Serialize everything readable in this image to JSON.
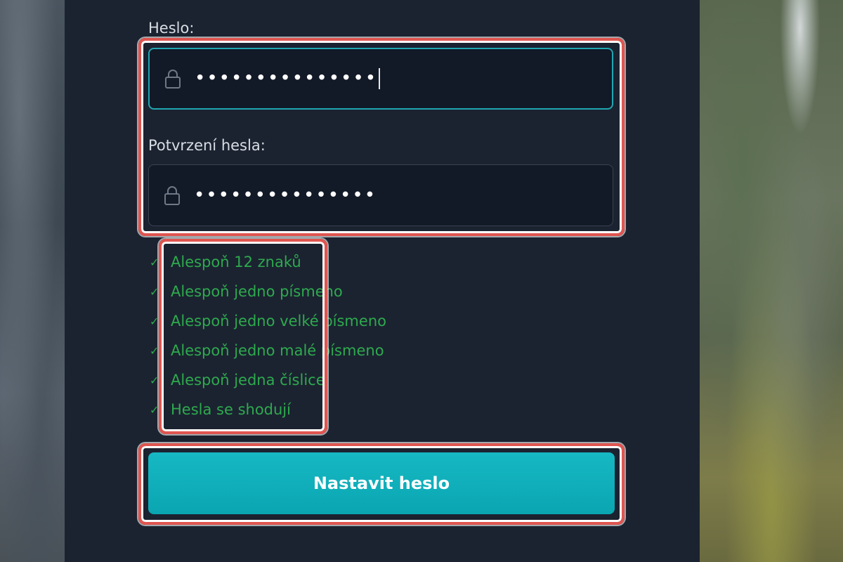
{
  "form": {
    "password_label": "Heslo:",
    "password_value": "•••••••••••••••",
    "confirm_label": "Potvrzení hesla:",
    "confirm_value": "•••••••••••••••",
    "lock_icon": "lock-icon"
  },
  "requirements": [
    {
      "text": "Alespoň 12 znaků",
      "met": true
    },
    {
      "text": "Alespoň jedno písmeno",
      "met": true
    },
    {
      "text": "Alespoň jedno velké písmeno",
      "met": true
    },
    {
      "text": "Alespoň jedno malé písmeno",
      "met": true
    },
    {
      "text": "Alespoň jedna číslice",
      "met": true
    },
    {
      "text": "Hesla se shodují",
      "met": true
    }
  ],
  "check_glyph": "✓",
  "submit_label": "Nastavit heslo",
  "colors": {
    "accent": "#0fb0bc",
    "success": "#2eaa4d",
    "panel": "#1b2331",
    "highlight": "#e05550"
  }
}
